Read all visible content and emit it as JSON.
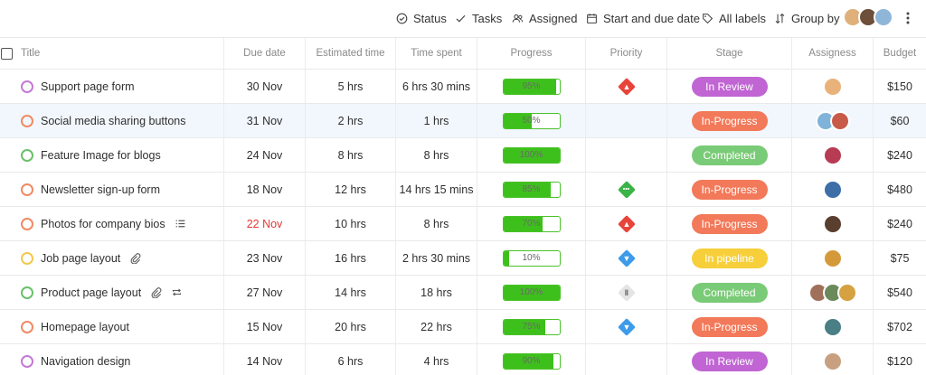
{
  "toolbar": {
    "status": "Status",
    "tasks": "Tasks",
    "assigned": "Assigned",
    "dates": "Start and due date",
    "labels": "All labels",
    "group_by": "Group by"
  },
  "columns": {
    "title": "Title",
    "due": "Due date",
    "est": "Estimated time",
    "spent": "Time spent",
    "progress": "Progress",
    "priority": "Priority",
    "stage": "Stage",
    "assignees": "Assigness",
    "budget": "Budget"
  },
  "colors": {
    "in_review": "#c065d3",
    "in_progress": "#f2795a",
    "completed": "#7acb77",
    "in_pipeline": "#f6cf3a",
    "progress_green": "#3ec01c",
    "overdue": "#e53935"
  },
  "rows": [
    {
      "title": "Support page form",
      "ring": "#c37ad3",
      "icons": [],
      "due": "30 Nov",
      "overdue": false,
      "est": "5 hrs",
      "spent": "6 hrs 30 mins",
      "progress": 95,
      "progress_label": "95%",
      "priority": "high",
      "stage": "In Review",
      "stage_color": "#c065d3",
      "assignees": [
        "#e8b27a"
      ],
      "budget": "$150",
      "highlight": false
    },
    {
      "title": "Social media sharing buttons",
      "ring": "#f08a65",
      "icons": [],
      "due": "31 Nov",
      "overdue": false,
      "est": "2 hrs",
      "spent": "1 hrs",
      "progress": 50,
      "progress_label": "50%",
      "priority": "none",
      "stage": "In-Progress",
      "stage_color": "#f2795a",
      "assignees": [
        "#7fb3d9",
        "#c85a4a"
      ],
      "budget": "$60",
      "highlight": true
    },
    {
      "title": "Feature Image for blogs",
      "ring": "#6bc06a",
      "icons": [],
      "due": "24 Nov",
      "overdue": false,
      "est": "8 hrs",
      "spent": "8 hrs",
      "progress": 100,
      "progress_label": "100%",
      "priority": "none",
      "stage": "Completed",
      "stage_color": "#7acb77",
      "assignees": [
        "#b83b54"
      ],
      "budget": "$240",
      "highlight": false
    },
    {
      "title": "Newsletter sign-up form",
      "ring": "#f08a65",
      "icons": [],
      "due": "18 Nov",
      "overdue": false,
      "est": "12 hrs",
      "spent": "14 hrs 15 mins",
      "progress": 85,
      "progress_label": "85%",
      "priority": "medium",
      "stage": "In-Progress",
      "stage_color": "#f2795a",
      "assignees": [
        "#3d6ea8"
      ],
      "budget": "$480",
      "highlight": false
    },
    {
      "title": "Photos for company bios",
      "ring": "#f08a65",
      "icons": [
        "list-icon"
      ],
      "due": "22 Nov",
      "overdue": true,
      "est": "10 hrs",
      "spent": "8 hrs",
      "progress": 70,
      "progress_label": "70%",
      "priority": "high",
      "stage": "In-Progress",
      "stage_color": "#f2795a",
      "assignees": [
        "#5a3e2e"
      ],
      "budget": "$240",
      "highlight": false
    },
    {
      "title": "Job page layout",
      "ring": "#f2c94c",
      "icons": [
        "attachment-icon"
      ],
      "due": "23 Nov",
      "overdue": false,
      "est": "16 hrs",
      "spent": "2 hrs 30 mins",
      "progress": 10,
      "progress_label": "10%",
      "priority": "low",
      "stage": "In pipeline",
      "stage_color": "#f6cf3a",
      "assignees": [
        "#d49a3a"
      ],
      "budget": "$75",
      "highlight": false
    },
    {
      "title": "Product page layout",
      "ring": "#6bc06a",
      "icons": [
        "attachment-icon",
        "repeat-icon"
      ],
      "due": "27 Nov",
      "overdue": false,
      "est": "14 hrs",
      "spent": "18 hrs",
      "progress": 100,
      "progress_label": "100%",
      "priority": "paused",
      "stage": "Completed",
      "stage_color": "#7acb77",
      "assignees": [
        "#a0705a",
        "#6a8a5a",
        "#d6a140"
      ],
      "budget": "$540",
      "highlight": false
    },
    {
      "title": "Homepage layout",
      "ring": "#f08a65",
      "icons": [],
      "due": "15 Nov",
      "overdue": false,
      "est": "20 hrs",
      "spent": "22 hrs",
      "progress": 75,
      "progress_label": "75%",
      "priority": "low",
      "stage": "In-Progress",
      "stage_color": "#f2795a",
      "assignees": [
        "#4a7f86"
      ],
      "budget": "$702",
      "highlight": false
    },
    {
      "title": "Navigation design",
      "ring": "#c37ad3",
      "icons": [],
      "due": "14 Nov",
      "overdue": false,
      "est": "6 hrs",
      "spent": "4 hrs",
      "progress": 90,
      "progress_label": "90%",
      "priority": "none",
      "stage": "In Review",
      "stage_color": "#c065d3",
      "assignees": [
        "#c8a080"
      ],
      "budget": "$120",
      "highlight": false
    }
  ]
}
